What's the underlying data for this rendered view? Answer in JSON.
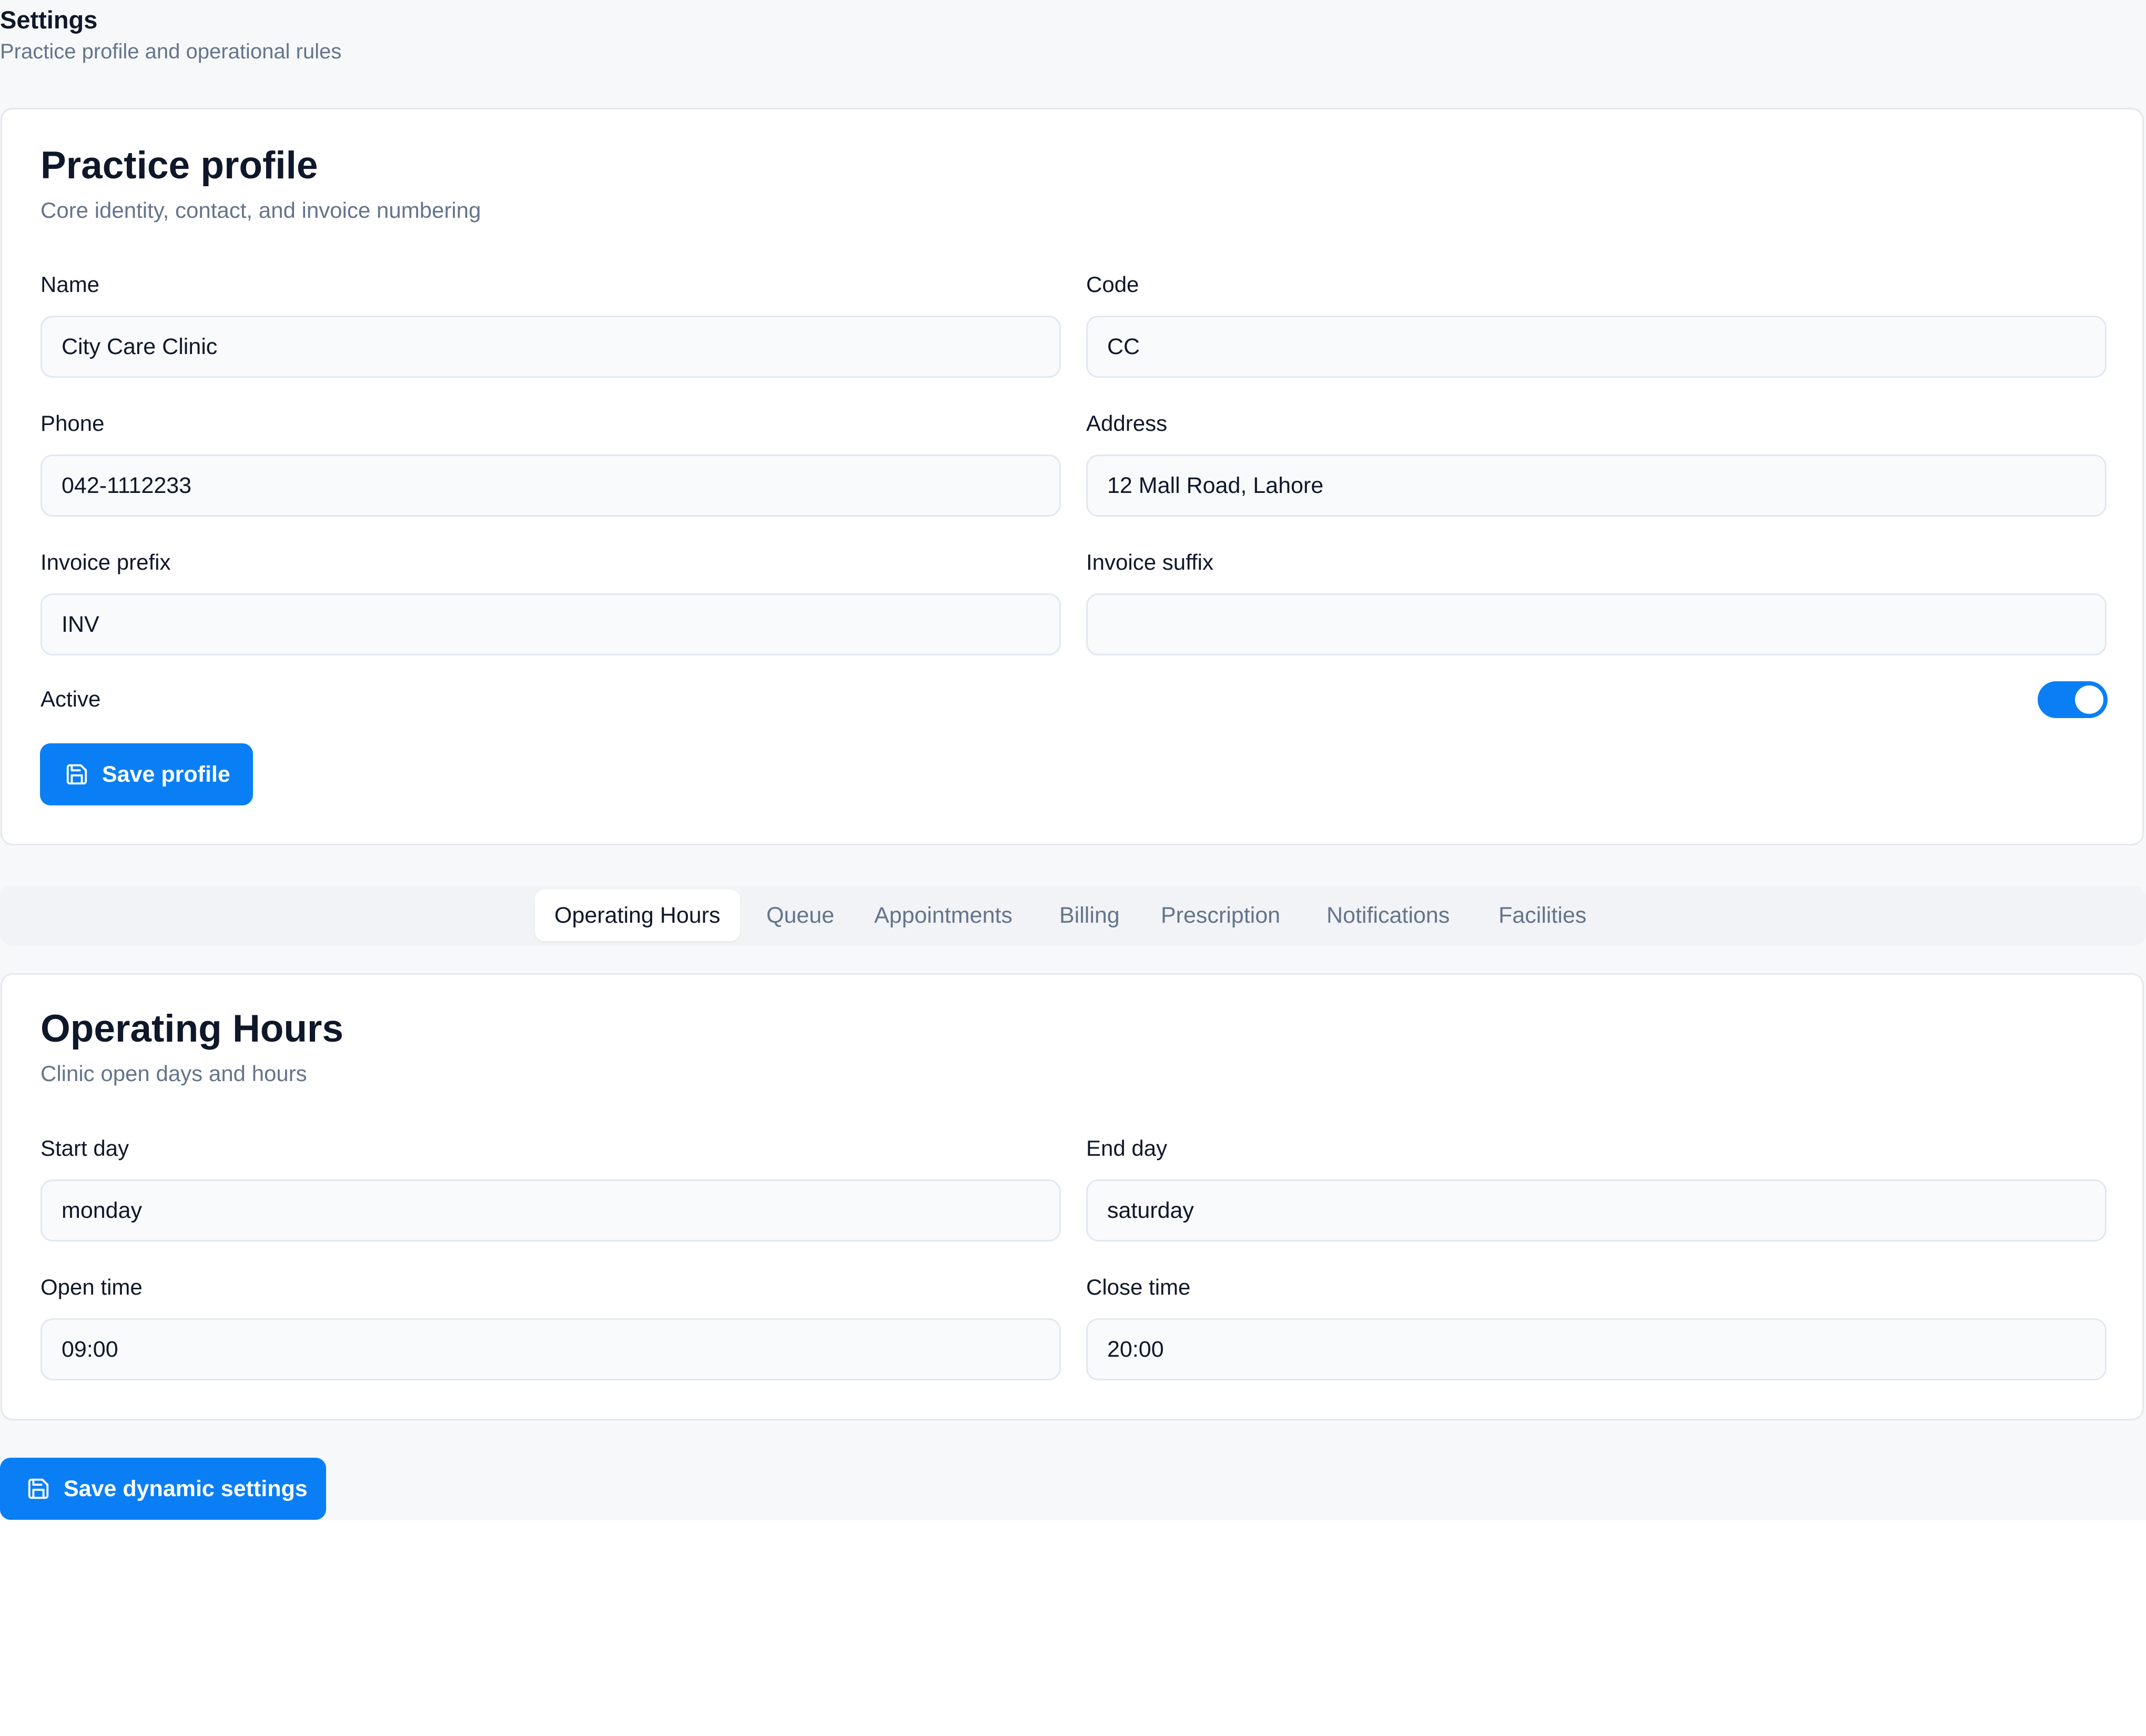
{
  "header": {
    "title": "Settings",
    "subtitle": "Practice profile and operational rules"
  },
  "profile": {
    "title": "Practice profile",
    "description": "Core identity, contact, and invoice numbering",
    "fields": {
      "name": {
        "label": "Name",
        "value": "City Care Clinic"
      },
      "code": {
        "label": "Code",
        "value": "CC"
      },
      "phone": {
        "label": "Phone",
        "value": "042-1112233"
      },
      "address": {
        "label": "Address",
        "value": "12 Mall Road, Lahore"
      },
      "invoice_prefix": {
        "label": "Invoice prefix",
        "value": "INV"
      },
      "invoice_suffix": {
        "label": "Invoice suffix",
        "value": ""
      }
    },
    "active": {
      "label": "Active",
      "on": true
    },
    "save_label": "Save profile"
  },
  "tabs": [
    {
      "label": "Operating Hours",
      "active": true
    },
    {
      "label": "Queue",
      "active": false
    },
    {
      "label": "Appointments",
      "active": false
    },
    {
      "label": "Billing",
      "active": false
    },
    {
      "label": "Prescription",
      "active": false
    },
    {
      "label": "Notifications",
      "active": false
    },
    {
      "label": "Facilities",
      "active": false
    }
  ],
  "hours": {
    "title": "Operating Hours",
    "description": "Clinic open days and hours",
    "fields": {
      "start_day": {
        "label": "Start day",
        "value": "monday"
      },
      "end_day": {
        "label": "End day",
        "value": "saturday"
      },
      "open_time": {
        "label": "Open time",
        "value": "09:00"
      },
      "close_time": {
        "label": "Close time",
        "value": "20:00"
      }
    }
  },
  "save_dynamic_label": "Save dynamic settings",
  "colors": {
    "accent": "#0a7ff5",
    "muted_text": "#64748b",
    "page_background": "#f7f8fa"
  },
  "icons": {
    "save": "floppy-disk-icon"
  }
}
